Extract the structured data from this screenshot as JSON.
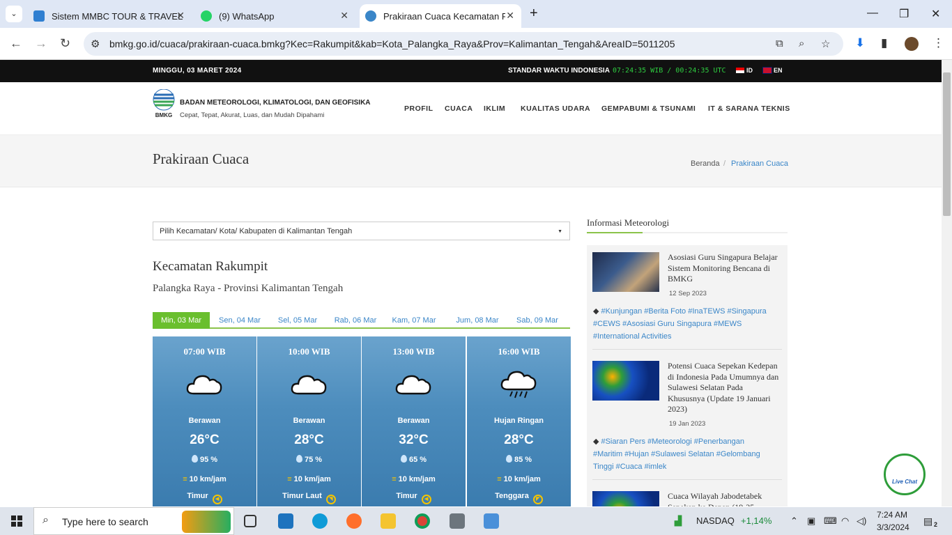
{
  "browser": {
    "tabs": [
      {
        "title": "Sistem MMBC TOUR & TRAVEL",
        "favicon_color": "#2f7fd1"
      },
      {
        "title": "(9) WhatsApp",
        "favicon_color": "#25d366"
      },
      {
        "title": "Prakiraan Cuaca Kecamatan Rak",
        "favicon_color": "#3a86c8",
        "active": true
      }
    ],
    "url": "bmkg.go.id/cuaca/prakiraan-cuaca.bmkg?Kec=Rakumpit&kab=Kota_Palangka_Raya&Prov=Kalimantan_Tengah&AreaID=5011205"
  },
  "topbar": {
    "date": "MINGGU, 03 MARET 2024",
    "standard_label": "STANDAR WAKTU INDONESIA",
    "clock": "07:24:35 WIB / 00:24:35 UTC",
    "lang_id": "ID",
    "lang_en": "EN"
  },
  "header": {
    "org_name": "BADAN METEOROLOGI, KLIMATOLOGI, DAN GEOFISIKA",
    "tagline": "Cepat, Tepat, Akurat, Luas, dan Mudah Dipahami",
    "logo_text": "BMKG",
    "nav": [
      "PROFIL",
      "CUACA",
      "IKLIM",
      "KUALITAS UDARA",
      "GEMPABUMI & TSUNAMI",
      "IT & SARANA TEKNIS"
    ]
  },
  "title_bar": {
    "title": "Prakiraan Cuaca",
    "breadcrumb_home": "Beranda",
    "breadcrumb_sep": "/",
    "breadcrumb_current": "Prakiraan Cuaca"
  },
  "forecast": {
    "select_placeholder": "Pilih Kecamatan/ Kota/ Kabupaten di Kalimantan Tengah",
    "kecamatan": "Kecamatan Rakumpit",
    "location": "Palangka Raya - Provinsi Kalimantan Tengah",
    "days": [
      "Min, 03 Mar",
      "Sen, 04 Mar",
      "Sel, 05 Mar",
      "Rab, 06 Mar",
      "Kam, 07 Mar",
      "Jum, 08 Mar",
      "Sab, 09 Mar"
    ],
    "cards": [
      {
        "time": "07:00 WIB",
        "condition": "Berawan",
        "temp": "26°C",
        "humidity": "95 %",
        "wind": "10 km/jam",
        "direction": "Timur",
        "icon": "cloud-icon"
      },
      {
        "time": "10:00 WIB",
        "condition": "Berawan",
        "temp": "28°C",
        "humidity": "75 %",
        "wind": "10 km/jam",
        "direction": "Timur Laut",
        "icon": "cloud-icon"
      },
      {
        "time": "13:00 WIB",
        "condition": "Berawan",
        "temp": "32°C",
        "humidity": "65 %",
        "wind": "10 km/jam",
        "direction": "Timur",
        "icon": "cloud-icon"
      },
      {
        "time": "16:00 WIB",
        "condition": "Hujan Ringan",
        "temp": "28°C",
        "humidity": "85 %",
        "wind": "10 km/jam",
        "direction": "Tenggara",
        "icon": "rain-cloud-icon"
      }
    ]
  },
  "sidebar": {
    "title": "Informasi Meteorologi",
    "articles": [
      {
        "title": "Asosiasi Guru Singapura Belajar Sistem Monitoring Bencana di BMKG",
        "date": "12 Sep 2023",
        "tags": "#Kunjungan #Berita Foto #InaTEWS #Singapura #CEWS #Asosiasi Guru Singapura #MEWS #International Activities"
      },
      {
        "title": "Potensi Cuaca Sepekan Kedepan di Indonesia Pada Umumnya dan Sulawesi Selatan Pada Khususnya (Update 19 Januari 2023)",
        "date": "19 Jan 2023",
        "tags": "#Siaran Pers #Meteorologi #Penerbangan #Maritim #Hujan #Sulawesi Selatan #Gelombang Tinggi #Cuaca #imlek"
      },
      {
        "title": "Cuaca Wilayah Jabodetabek Sepekan ke Depan (19-25"
      }
    ]
  },
  "livechat": {
    "label": "Live Chat"
  },
  "taskbar": {
    "search_placeholder": "Type here to search",
    "stock_name": "NASDAQ",
    "stock_change": "+1,14%",
    "time": "7:24 AM",
    "date": "3/3/2024",
    "notifications": "2"
  }
}
